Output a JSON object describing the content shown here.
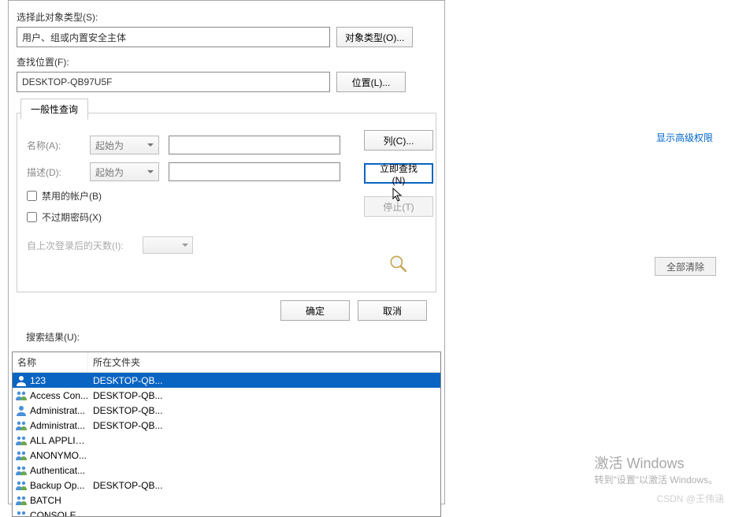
{
  "dialog": {
    "objectTypeLabel": "选择此对象类型(S):",
    "objectTypeValue": "用户、组或内置安全主体",
    "objectTypeBtn": "对象类型(O)...",
    "locationLabel": "查找位置(F):",
    "locationValue": "DESKTOP-QB97U5F",
    "locationBtn": "位置(L)...",
    "generalTab": "一般性查询",
    "nameLabel": "名称(A):",
    "nameCombo": "起始为",
    "descLabel": "描述(D):",
    "descCombo": "起始为",
    "disabledAccounts": "禁用的帐户(B)",
    "noExpirePwd": "不过期密码(X)",
    "daysSinceLogin": "自上次登录后的天数(I):",
    "columnsBtn": "列(C)...",
    "findNowBtn": "立即查找(N)",
    "stopBtn": "停止(T)",
    "okBtn": "确定",
    "cancelBtn": "取消",
    "resultsLabel": "搜索结果(U):",
    "colName": "名称",
    "colFolder": "所在文件夹",
    "results": [
      {
        "name": "123",
        "folder": "DESKTOP-QB...",
        "type": "user",
        "selected": true
      },
      {
        "name": "Access Con...",
        "folder": "DESKTOP-QB...",
        "type": "group"
      },
      {
        "name": "Administrat...",
        "folder": "DESKTOP-QB...",
        "type": "user"
      },
      {
        "name": "Administrat...",
        "folder": "DESKTOP-QB...",
        "type": "group"
      },
      {
        "name": "ALL APPLIC...",
        "folder": "",
        "type": "group"
      },
      {
        "name": "ANONYMO...",
        "folder": "",
        "type": "group"
      },
      {
        "name": "Authenticat...",
        "folder": "",
        "type": "group"
      },
      {
        "name": "Backup Op...",
        "folder": "DESKTOP-QB...",
        "type": "group"
      },
      {
        "name": "BATCH",
        "folder": "",
        "type": "group"
      },
      {
        "name": "CONSOLE ...",
        "folder": "",
        "type": "group"
      }
    ]
  },
  "right": {
    "advLink": "显示高级权限",
    "clearBtn": "全部清除",
    "activateTitle": "激活 Windows",
    "activateSub": "转到\"设置\"以激活 Windows。",
    "watermark": "CSDN @王伟涵"
  }
}
